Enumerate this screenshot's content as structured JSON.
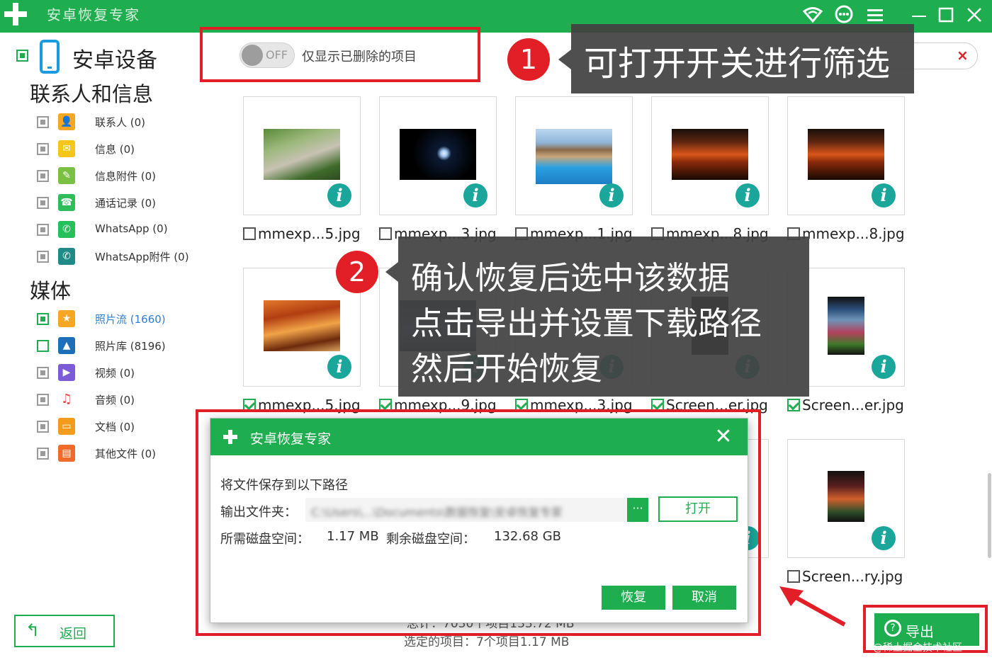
{
  "app": {
    "title": "安卓恢复专家",
    "brand_color": "#1fae4f",
    "window_icons": [
      "wifi-icon",
      "chat-icon",
      "menu-icon",
      "minimize-icon",
      "maximize-icon",
      "close-icon"
    ]
  },
  "sidebar": {
    "device_label": "安卓设备",
    "contacts_section": "联系人和信息",
    "contacts_items": [
      {
        "label": "联系人 (0)",
        "icon": "contacts-icon",
        "color": "#f5a623"
      },
      {
        "label": "信息 (0)",
        "icon": "message-icon",
        "color": "#f5a623"
      },
      {
        "label": "信息附件 (0)",
        "icon": "attachment-icon",
        "color": "#7ac143"
      },
      {
        "label": "通话记录 (0)",
        "icon": "phone-icon",
        "color": "#2ebd59"
      },
      {
        "label": "WhatsApp (0)",
        "icon": "whatsapp-icon",
        "color": "#25c05c"
      },
      {
        "label": "WhatsApp附件 (0)",
        "icon": "whatsapp-attachment-icon",
        "color": "#1f8a86"
      }
    ],
    "media_section": "媒体",
    "media_items": [
      {
        "label": "照片流 (1660)",
        "icon": "star-icon",
        "color": "#f5a623",
        "active": true
      },
      {
        "label": "照片库 (8196)",
        "icon": "image-icon",
        "color": "#1d6fb8",
        "active": false
      },
      {
        "label": "视频 (0)",
        "icon": "video-icon",
        "color": "#7b5cd6",
        "active": false
      },
      {
        "label": "音频 (0)",
        "icon": "music-icon",
        "color": "#e84545",
        "active": false
      },
      {
        "label": "文档 (0)",
        "icon": "document-icon",
        "color": "#f29b1d",
        "active": false
      },
      {
        "label": "其他文件 (0)",
        "icon": "other-file-icon",
        "color": "#f06b2a",
        "active": false
      }
    ],
    "back_label": "返回"
  },
  "toolbar": {
    "toggle_state": "OFF",
    "filter_label": "仅显示已删除的项目"
  },
  "grid": {
    "row1": [
      {
        "name": "mmexp...5.jpg",
        "checked": false
      },
      {
        "name": "mmexp...3.jpg",
        "checked": false
      },
      {
        "name": "mmexp...1.jpg",
        "checked": false
      },
      {
        "name": "mmexp...8.jpg",
        "checked": false
      },
      {
        "name": "mmexp...8.jpg",
        "checked": false
      }
    ],
    "row2": [
      {
        "name": "mmexp...5.jpg",
        "checked": true
      },
      {
        "name": "mmexp...9.jpg",
        "checked": true
      },
      {
        "name": "mmexp...3.jpg",
        "checked": true
      },
      {
        "name": "Screen...er.jpg",
        "checked": true
      },
      {
        "name": "Screen...er.jpg",
        "checked": true
      }
    ],
    "row3_visible": [
      {
        "name": "Screen...ry.jpg",
        "checked": false
      }
    ]
  },
  "annotations": {
    "step1_number": "1",
    "step1_text": "可打开开关进行筛选",
    "step2_number": "2",
    "step2_lines": [
      "确认恢复后选中该数据",
      "点击导出并设置下载路径",
      "然后开始恢复"
    ]
  },
  "dialog": {
    "title": "安卓恢复专家",
    "save_prompt": "将文件保存到以下路径",
    "output_label": "输出文件夹：",
    "output_path": "C:\\Users\\...\\Documents\\数据恢复\\安卓恢复专家",
    "browse_label": "···",
    "open_label": "打开",
    "disk_required_label": "所需磁盘空间：",
    "disk_required_value": "1.17 MB",
    "disk_free_label": "剩余磁盘空间：",
    "disk_free_value": "132.68 GB",
    "restore_label": "恢复",
    "cancel_label": "取消"
  },
  "footer": {
    "total_text": "总计：7030个项目133.72 MB",
    "selected_text": "选定的项目：7个项目1.17 MB",
    "export_label": "导出",
    "watermark": "@稀土掘金技术社区"
  }
}
